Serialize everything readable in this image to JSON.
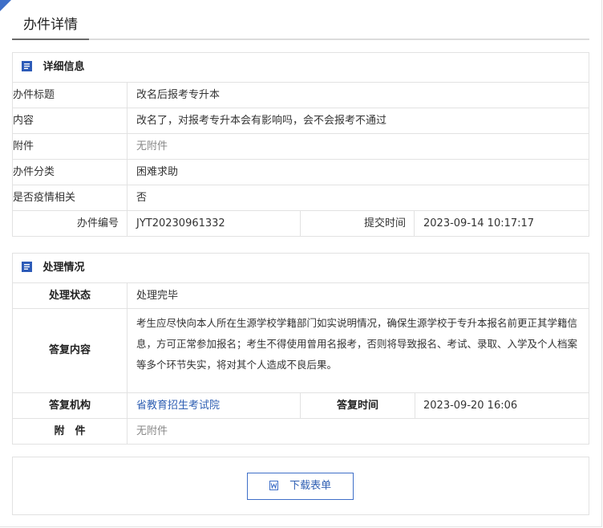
{
  "page": {
    "title": "办件详情"
  },
  "detail": {
    "heading": "详细信息",
    "rows": [
      {
        "label": "办件标题",
        "value": "改名后报考专升本"
      },
      {
        "label": "内容",
        "value": "改名了，对报考专升本会有影响吗，会不会报考不通过"
      },
      {
        "label": "附件",
        "value": "无附件"
      },
      {
        "label": "办件分类",
        "value": "困难求助"
      },
      {
        "label": "是否疫情相关",
        "value": "否"
      }
    ],
    "number_label": "办件编号",
    "number_value": "JYT20230961332",
    "submit_label": "提交时间",
    "submit_value": "2023-09-14 10:17:17"
  },
  "process": {
    "heading": "处理情况",
    "status_label": "处理状态",
    "status_value": "处理完毕",
    "reply_label": "答复内容",
    "reply_value": "考生应尽快向本人所在生源学校学籍部门如实说明情况，确保生源学校于专升本报名前更正其学籍信息，方可正常参加报名；考生不得使用曾用名报考，否则将导致报名、考试、录取、入学及个人档案等多个环节失实，将对其个人造成不良后果。",
    "org_label": "答复机构",
    "org_value": "省教育招生考试院",
    "time_label": "答复时间",
    "time_value": "2023-09-20 16:06",
    "attach_label": "附　件",
    "attach_value": "无附件"
  },
  "actions": {
    "download_label": "下载表单"
  },
  "colors": {
    "accent": "#3f6fc8",
    "link": "#2f5fb3"
  },
  "icons": {
    "section": "document-icon",
    "download": "word-file-icon"
  }
}
